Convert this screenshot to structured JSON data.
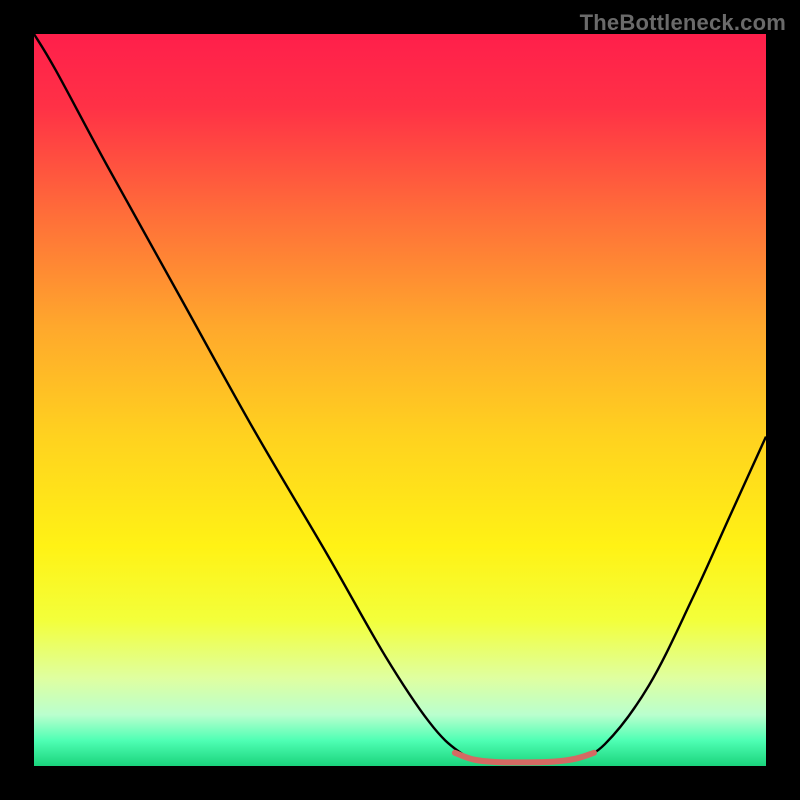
{
  "watermark": "TheBottleneck.com",
  "chart_data": {
    "type": "line",
    "title": "",
    "xlabel": "",
    "ylabel": "",
    "xlim": [
      0,
      100
    ],
    "ylim": [
      0,
      100
    ],
    "background_gradient": {
      "stops": [
        {
          "offset": 0.0,
          "color": "#ff1f4b"
        },
        {
          "offset": 0.1,
          "color": "#ff3146"
        },
        {
          "offset": 0.25,
          "color": "#ff6f39"
        },
        {
          "offset": 0.4,
          "color": "#ffa82c"
        },
        {
          "offset": 0.55,
          "color": "#ffd21f"
        },
        {
          "offset": 0.7,
          "color": "#fff215"
        },
        {
          "offset": 0.8,
          "color": "#f3ff3a"
        },
        {
          "offset": 0.88,
          "color": "#dfffa0"
        },
        {
          "offset": 0.93,
          "color": "#baffce"
        },
        {
          "offset": 0.965,
          "color": "#4fffb4"
        },
        {
          "offset": 1.0,
          "color": "#1ad47c"
        }
      ]
    },
    "series": [
      {
        "name": "curve",
        "color": "#000000",
        "width": 2.4,
        "points": [
          {
            "x": 0.0,
            "y": 100.0
          },
          {
            "x": 3.0,
            "y": 95.0
          },
          {
            "x": 10.0,
            "y": 82.0
          },
          {
            "x": 20.0,
            "y": 64.0
          },
          {
            "x": 30.0,
            "y": 46.0
          },
          {
            "x": 40.0,
            "y": 29.0
          },
          {
            "x": 48.0,
            "y": 15.0
          },
          {
            "x": 54.0,
            "y": 6.0
          },
          {
            "x": 58.0,
            "y": 2.0
          },
          {
            "x": 61.0,
            "y": 0.8
          },
          {
            "x": 65.0,
            "y": 0.5
          },
          {
            "x": 70.0,
            "y": 0.5
          },
          {
            "x": 74.0,
            "y": 1.0
          },
          {
            "x": 78.0,
            "y": 3.0
          },
          {
            "x": 84.0,
            "y": 11.0
          },
          {
            "x": 90.0,
            "y": 23.0
          },
          {
            "x": 95.0,
            "y": 34.0
          },
          {
            "x": 100.0,
            "y": 45.0
          }
        ]
      }
    ],
    "bottom_marker": {
      "color": "#d46a63",
      "width": 6,
      "points": [
        {
          "x": 57.5,
          "y": 1.8
        },
        {
          "x": 60.0,
          "y": 0.9
        },
        {
          "x": 63.0,
          "y": 0.55
        },
        {
          "x": 67.0,
          "y": 0.5
        },
        {
          "x": 71.0,
          "y": 0.6
        },
        {
          "x": 74.0,
          "y": 1.0
        },
        {
          "x": 76.5,
          "y": 1.8
        }
      ]
    }
  }
}
